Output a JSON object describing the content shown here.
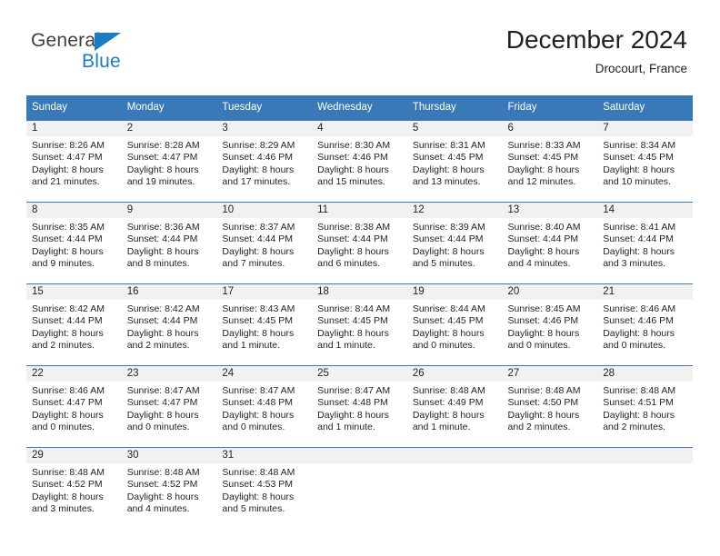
{
  "brand": {
    "name_part1": "General",
    "name_part2": "Blue",
    "logo_icon": "triangle-icon"
  },
  "header": {
    "title": "December 2024",
    "subtitle": "Drocourt, France"
  },
  "colors": {
    "header_blue": "#3a79b8",
    "brand_blue": "#1a7dc4",
    "daynum_band": "#f1f1f1",
    "text": "#231f20",
    "page_background": "#ffffff"
  },
  "calendar": {
    "weekday_headers": [
      "Sunday",
      "Monday",
      "Tuesday",
      "Wednesday",
      "Thursday",
      "Friday",
      "Saturday"
    ],
    "weeks": [
      [
        {
          "day": "1",
          "sunrise": "Sunrise: 8:26 AM",
          "sunset": "Sunset: 4:47 PM",
          "daylight_line1": "Daylight: 8 hours",
          "daylight_line2": "and 21 minutes."
        },
        {
          "day": "2",
          "sunrise": "Sunrise: 8:28 AM",
          "sunset": "Sunset: 4:47 PM",
          "daylight_line1": "Daylight: 8 hours",
          "daylight_line2": "and 19 minutes."
        },
        {
          "day": "3",
          "sunrise": "Sunrise: 8:29 AM",
          "sunset": "Sunset: 4:46 PM",
          "daylight_line1": "Daylight: 8 hours",
          "daylight_line2": "and 17 minutes."
        },
        {
          "day": "4",
          "sunrise": "Sunrise: 8:30 AM",
          "sunset": "Sunset: 4:46 PM",
          "daylight_line1": "Daylight: 8 hours",
          "daylight_line2": "and 15 minutes."
        },
        {
          "day": "5",
          "sunrise": "Sunrise: 8:31 AM",
          "sunset": "Sunset: 4:45 PM",
          "daylight_line1": "Daylight: 8 hours",
          "daylight_line2": "and 13 minutes."
        },
        {
          "day": "6",
          "sunrise": "Sunrise: 8:33 AM",
          "sunset": "Sunset: 4:45 PM",
          "daylight_line1": "Daylight: 8 hours",
          "daylight_line2": "and 12 minutes."
        },
        {
          "day": "7",
          "sunrise": "Sunrise: 8:34 AM",
          "sunset": "Sunset: 4:45 PM",
          "daylight_line1": "Daylight: 8 hours",
          "daylight_line2": "and 10 minutes."
        }
      ],
      [
        {
          "day": "8",
          "sunrise": "Sunrise: 8:35 AM",
          "sunset": "Sunset: 4:44 PM",
          "daylight_line1": "Daylight: 8 hours",
          "daylight_line2": "and 9 minutes."
        },
        {
          "day": "9",
          "sunrise": "Sunrise: 8:36 AM",
          "sunset": "Sunset: 4:44 PM",
          "daylight_line1": "Daylight: 8 hours",
          "daylight_line2": "and 8 minutes."
        },
        {
          "day": "10",
          "sunrise": "Sunrise: 8:37 AM",
          "sunset": "Sunset: 4:44 PM",
          "daylight_line1": "Daylight: 8 hours",
          "daylight_line2": "and 7 minutes."
        },
        {
          "day": "11",
          "sunrise": "Sunrise: 8:38 AM",
          "sunset": "Sunset: 4:44 PM",
          "daylight_line1": "Daylight: 8 hours",
          "daylight_line2": "and 6 minutes."
        },
        {
          "day": "12",
          "sunrise": "Sunrise: 8:39 AM",
          "sunset": "Sunset: 4:44 PM",
          "daylight_line1": "Daylight: 8 hours",
          "daylight_line2": "and 5 minutes."
        },
        {
          "day": "13",
          "sunrise": "Sunrise: 8:40 AM",
          "sunset": "Sunset: 4:44 PM",
          "daylight_line1": "Daylight: 8 hours",
          "daylight_line2": "and 4 minutes."
        },
        {
          "day": "14",
          "sunrise": "Sunrise: 8:41 AM",
          "sunset": "Sunset: 4:44 PM",
          "daylight_line1": "Daylight: 8 hours",
          "daylight_line2": "and 3 minutes."
        }
      ],
      [
        {
          "day": "15",
          "sunrise": "Sunrise: 8:42 AM",
          "sunset": "Sunset: 4:44 PM",
          "daylight_line1": "Daylight: 8 hours",
          "daylight_line2": "and 2 minutes."
        },
        {
          "day": "16",
          "sunrise": "Sunrise: 8:42 AM",
          "sunset": "Sunset: 4:44 PM",
          "daylight_line1": "Daylight: 8 hours",
          "daylight_line2": "and 2 minutes."
        },
        {
          "day": "17",
          "sunrise": "Sunrise: 8:43 AM",
          "sunset": "Sunset: 4:45 PM",
          "daylight_line1": "Daylight: 8 hours",
          "daylight_line2": "and 1 minute."
        },
        {
          "day": "18",
          "sunrise": "Sunrise: 8:44 AM",
          "sunset": "Sunset: 4:45 PM",
          "daylight_line1": "Daylight: 8 hours",
          "daylight_line2": "and 1 minute."
        },
        {
          "day": "19",
          "sunrise": "Sunrise: 8:44 AM",
          "sunset": "Sunset: 4:45 PM",
          "daylight_line1": "Daylight: 8 hours",
          "daylight_line2": "and 0 minutes."
        },
        {
          "day": "20",
          "sunrise": "Sunrise: 8:45 AM",
          "sunset": "Sunset: 4:46 PM",
          "daylight_line1": "Daylight: 8 hours",
          "daylight_line2": "and 0 minutes."
        },
        {
          "day": "21",
          "sunrise": "Sunrise: 8:46 AM",
          "sunset": "Sunset: 4:46 PM",
          "daylight_line1": "Daylight: 8 hours",
          "daylight_line2": "and 0 minutes."
        }
      ],
      [
        {
          "day": "22",
          "sunrise": "Sunrise: 8:46 AM",
          "sunset": "Sunset: 4:47 PM",
          "daylight_line1": "Daylight: 8 hours",
          "daylight_line2": "and 0 minutes."
        },
        {
          "day": "23",
          "sunrise": "Sunrise: 8:47 AM",
          "sunset": "Sunset: 4:47 PM",
          "daylight_line1": "Daylight: 8 hours",
          "daylight_line2": "and 0 minutes."
        },
        {
          "day": "24",
          "sunrise": "Sunrise: 8:47 AM",
          "sunset": "Sunset: 4:48 PM",
          "daylight_line1": "Daylight: 8 hours",
          "daylight_line2": "and 0 minutes."
        },
        {
          "day": "25",
          "sunrise": "Sunrise: 8:47 AM",
          "sunset": "Sunset: 4:48 PM",
          "daylight_line1": "Daylight: 8 hours",
          "daylight_line2": "and 1 minute."
        },
        {
          "day": "26",
          "sunrise": "Sunrise: 8:48 AM",
          "sunset": "Sunset: 4:49 PM",
          "daylight_line1": "Daylight: 8 hours",
          "daylight_line2": "and 1 minute."
        },
        {
          "day": "27",
          "sunrise": "Sunrise: 8:48 AM",
          "sunset": "Sunset: 4:50 PM",
          "daylight_line1": "Daylight: 8 hours",
          "daylight_line2": "and 2 minutes."
        },
        {
          "day": "28",
          "sunrise": "Sunrise: 8:48 AM",
          "sunset": "Sunset: 4:51 PM",
          "daylight_line1": "Daylight: 8 hours",
          "daylight_line2": "and 2 minutes."
        }
      ],
      [
        {
          "day": "29",
          "sunrise": "Sunrise: 8:48 AM",
          "sunset": "Sunset: 4:52 PM",
          "daylight_line1": "Daylight: 8 hours",
          "daylight_line2": "and 3 minutes."
        },
        {
          "day": "30",
          "sunrise": "Sunrise: 8:48 AM",
          "sunset": "Sunset: 4:52 PM",
          "daylight_line1": "Daylight: 8 hours",
          "daylight_line2": "and 4 minutes."
        },
        {
          "day": "31",
          "sunrise": "Sunrise: 8:48 AM",
          "sunset": "Sunset: 4:53 PM",
          "daylight_line1": "Daylight: 8 hours",
          "daylight_line2": "and 5 minutes."
        },
        {
          "day": "",
          "sunrise": "",
          "sunset": "",
          "daylight_line1": "",
          "daylight_line2": ""
        },
        {
          "day": "",
          "sunrise": "",
          "sunset": "",
          "daylight_line1": "",
          "daylight_line2": ""
        },
        {
          "day": "",
          "sunrise": "",
          "sunset": "",
          "daylight_line1": "",
          "daylight_line2": ""
        },
        {
          "day": "",
          "sunrise": "",
          "sunset": "",
          "daylight_line1": "",
          "daylight_line2": ""
        }
      ]
    ]
  }
}
